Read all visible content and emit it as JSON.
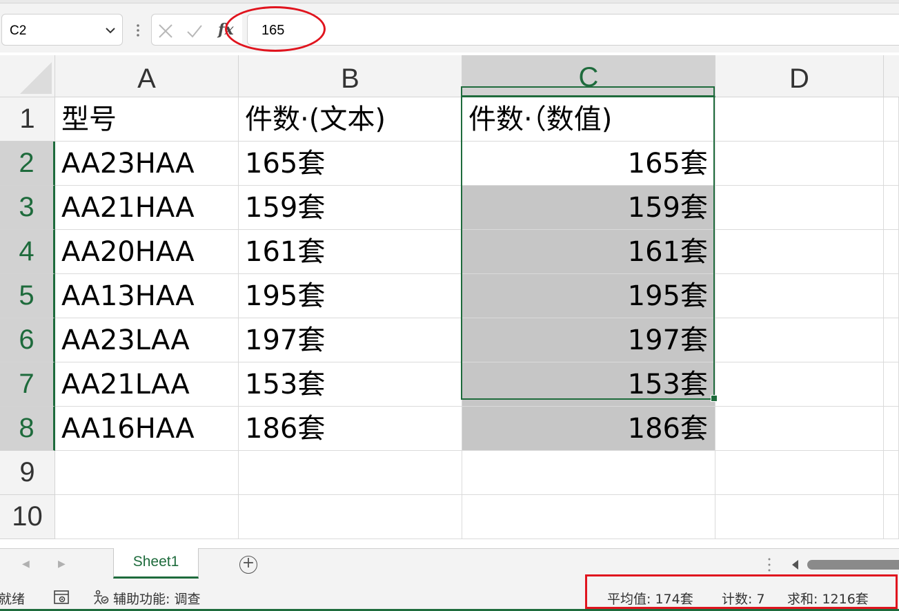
{
  "formula_bar": {
    "name_box": "C2",
    "fx_label": "fx",
    "formula_value": "165"
  },
  "columns": [
    {
      "id": "A",
      "label": "A"
    },
    {
      "id": "B",
      "label": "B"
    },
    {
      "id": "C",
      "label": "C"
    },
    {
      "id": "D",
      "label": "D"
    }
  ],
  "rows": [
    {
      "num": "1",
      "a": "型号",
      "b": "件数·(文本)",
      "c": "件数·（数值)"
    },
    {
      "num": "2",
      "a": "AA23HAA",
      "b": "165套",
      "c": "165套"
    },
    {
      "num": "3",
      "a": "AA21HAA",
      "b": "159套",
      "c": "159套"
    },
    {
      "num": "4",
      "a": "AA20HAA",
      "b": "161套",
      "c": "161套"
    },
    {
      "num": "5",
      "a": "AA13HAA",
      "b": "195套",
      "c": "195套"
    },
    {
      "num": "6",
      "a": "AA23LAA",
      "b": "197套",
      "c": "197套"
    },
    {
      "num": "7",
      "a": "AA21LAA",
      "b": "153套",
      "c": "153套"
    },
    {
      "num": "8",
      "a": "AA16HAA",
      "b": "186套",
      "c": "186套"
    },
    {
      "num": "9",
      "a": "",
      "b": "",
      "c": ""
    },
    {
      "num": "10",
      "a": "",
      "b": "",
      "c": ""
    }
  ],
  "sheet_tabs": [
    {
      "label": "Sheet1",
      "active": true
    }
  ],
  "status_bar": {
    "ready": "就绪",
    "accessibility": "辅助功能: 调查",
    "average": "平均值: 174套",
    "count": "计数: 7",
    "sum": "求和: 1216套"
  },
  "colors": {
    "accent_green": "#1e6b3c",
    "annotation_red": "#e0141e",
    "selection_fill": "#c6c6c6"
  }
}
